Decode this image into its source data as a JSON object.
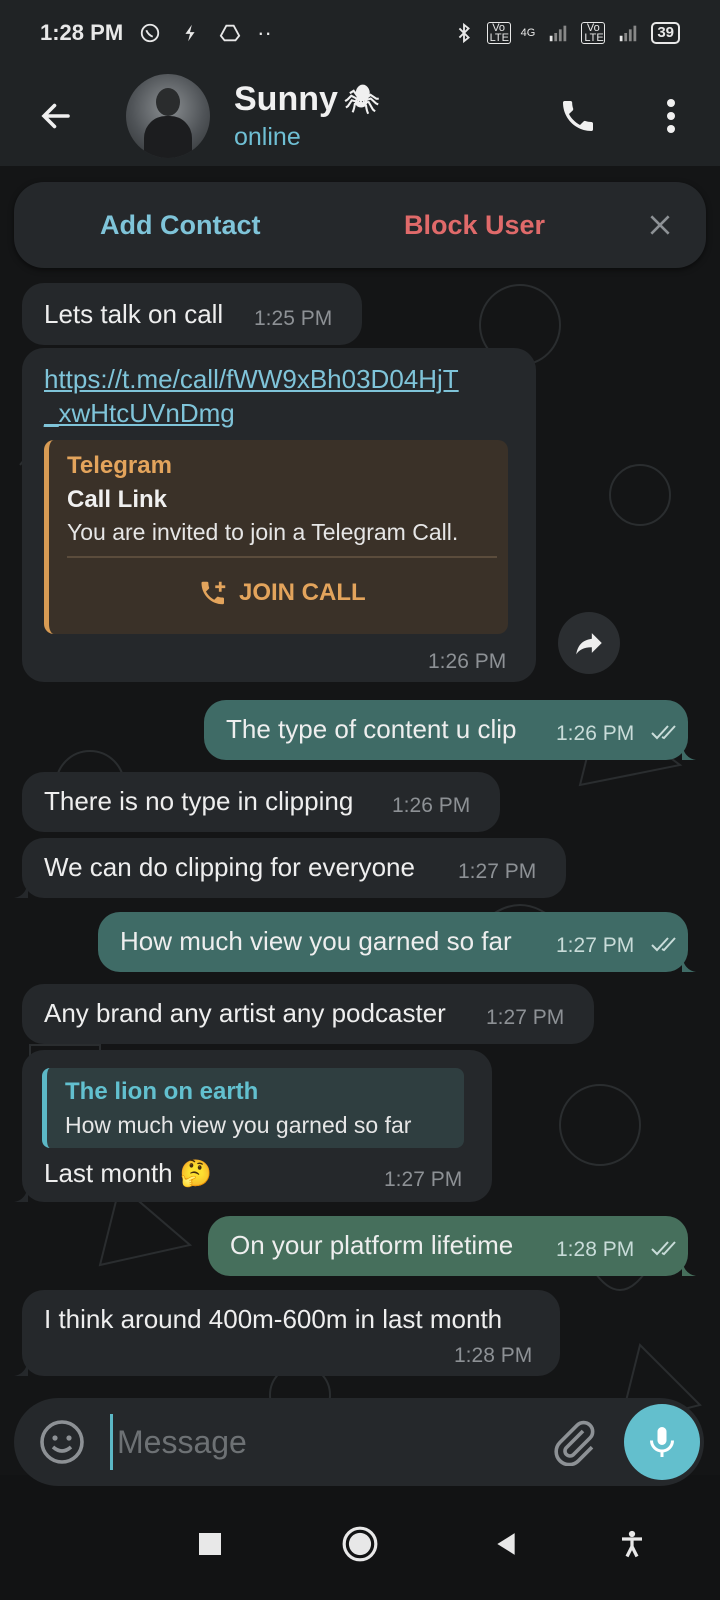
{
  "status_bar": {
    "time": "1:28 PM",
    "network_label": "4G",
    "volte_label_1": "Vo LTE",
    "volte_label_2": "Vo LTE",
    "battery": "39"
  },
  "header": {
    "contact_name": "Sunny",
    "contact_emoji": "🕷",
    "status": "online"
  },
  "action_bar": {
    "add_contact": "Add Contact",
    "block_user": "Block User"
  },
  "messages": [
    {
      "dir": "in",
      "text": "Lets talk on call",
      "time": "1:25 PM"
    },
    {
      "dir": "in",
      "link_line_1": "https://t.me/call/fWW9xBh03D04HjT",
      "link_line_2": "_xwHtcUVnDmg",
      "preview": {
        "site": "Telegram",
        "title": "Call Link",
        "description": "You are invited to join a Telegram Call.",
        "button": "JOIN CALL"
      },
      "time": "1:26 PM"
    },
    {
      "dir": "out",
      "text": "The type of content u clip",
      "time": "1:26 PM"
    },
    {
      "dir": "in",
      "text": "There is no type in clipping",
      "time": "1:26 PM"
    },
    {
      "dir": "in",
      "text": "We can do clipping for everyone",
      "time": "1:27 PM"
    },
    {
      "dir": "out",
      "text": "How much view you garned so far",
      "time": "1:27 PM"
    },
    {
      "dir": "in",
      "text": "Any brand any artist any podcaster",
      "time": "1:27 PM"
    },
    {
      "dir": "in",
      "reply_name": "The lion on earth",
      "reply_text": "How much view you garned so far",
      "text": "Last month 🤔",
      "time": "1:27 PM"
    },
    {
      "dir": "out",
      "text": "On your platform lifetime",
      "time": "1:28 PM"
    },
    {
      "dir": "in",
      "text": "I think around 400m-600m in last month",
      "time": "1:28 PM"
    }
  ],
  "composer": {
    "placeholder": "Message"
  },
  "colors": {
    "accent": "#63bfcd",
    "incoming_bubble": "#25282b",
    "outgoing_bubble": "#3f6b66",
    "block_red": "#e06a6a",
    "preview_orange": "#e3a45c"
  },
  "icons": {
    "back": "arrow-left-icon",
    "call": "phone-icon",
    "menu": "more-vertical-icon",
    "close": "close-icon",
    "share": "share-arrow-icon",
    "emoji": "smiley-icon",
    "attach": "paperclip-icon",
    "mic": "microphone-icon",
    "join_call": "phone-plus-icon"
  }
}
